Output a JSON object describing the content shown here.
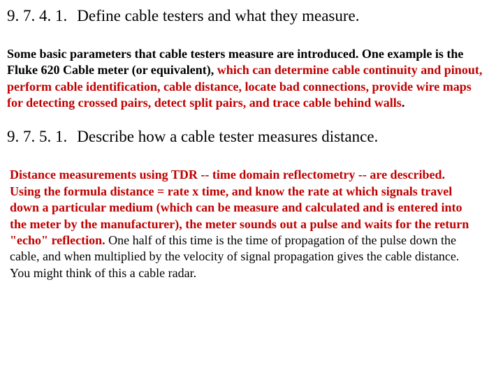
{
  "sections": [
    {
      "num": "9. 7. 4. 1.",
      "title": "Define cable testers and what they measure.",
      "body": {
        "lead": " Some basic parameters that cable testers measure are introduced. One example is the Fluke 620 Cable meter (or equivalent), ",
        "red": "which can determine cable continuity and pinout, perform cable identification, cable distance, locate bad connections, provide wire maps for detecting crossed pairs, detect split pairs, and trace cable behind walls",
        "tail": "."
      }
    },
    {
      "num": "9. 7. 5. 1.",
      "title": "Describe how a cable tester measures distance.",
      "body": {
        "red": "Distance measurements using TDR -- time domain reflectometry -- are described. Using the formula distance = rate x time, and know the rate at which signals travel down a particular medium (which can be measure and calculated and is entered into the meter by the manufacturer), the meter sounds out a pulse and waits for the return \"echo\" reflection.",
        "tail": " One half of this time is the time of propagation of the pulse down the cable, and when multiplied by the velocity of signal propagation gives the cable distance. You might think of this a cable radar."
      }
    }
  ]
}
